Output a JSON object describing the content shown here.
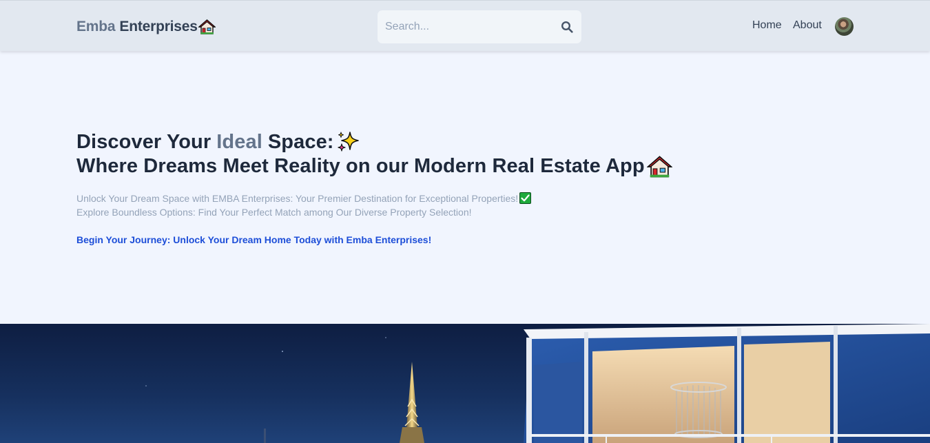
{
  "header": {
    "logo_part1": "Emba",
    "logo_part2": "Enterprises",
    "search_placeholder": "Search...",
    "nav": {
      "home": "Home",
      "about": "About"
    }
  },
  "hero": {
    "line1_prefix": "Discover Your",
    "line1_highlight": "Ideal",
    "line1_suffix": "Space:",
    "line2": "Where Dreams Meet Reality on our Modern Real Estate App",
    "sub1": "Unlock Your Dream Space with EMBA Enterprises: Your Premier Destination for Exceptional Properties!",
    "sub2": "Explore Boundless Options: Find Your Perfect Match among Our Diverse Property Selection!",
    "cta": "Begin Your Journey: Unlock Your Dream Home Today with Emba Enterprises!"
  },
  "colors": {
    "header_bg": "#e2e8f0",
    "page_bg": "#f1f5fe",
    "accent_link": "#1d4ed8",
    "muted_text": "#94a3b8"
  },
  "icons": [
    "house-emoji-icon",
    "search-icon",
    "sparkles-emoji-icon",
    "check-emoji-icon",
    "avatar"
  ]
}
